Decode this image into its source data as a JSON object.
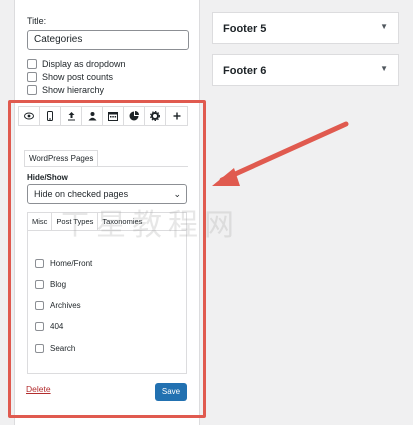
{
  "widget": {
    "title_label": "Title:",
    "title_value": "Categories",
    "options": [
      {
        "label": "Display as dropdown",
        "checked": false
      },
      {
        "label": "Show post counts",
        "checked": false
      },
      {
        "label": "Show hierarchy",
        "checked": false
      }
    ]
  },
  "visibility": {
    "toolbar_icons": [
      "eye-icon",
      "mobile-icon",
      "upload-icon",
      "user-icon",
      "calendar-icon",
      "pie-chart-icon",
      "gear-icon",
      "plus-icon"
    ],
    "tab": "WordPress Pages",
    "hide_show_label": "Hide/Show",
    "select_value": "Hide on checked pages",
    "subtabs": [
      "Misc",
      "Post Types",
      "Taxonomies"
    ],
    "misc_options": [
      "Home/Front",
      "Blog",
      "Archives",
      "404",
      "Search"
    ]
  },
  "actions": {
    "delete_label": "Delete",
    "save_label": "Save"
  },
  "footers": [
    {
      "title": "Footer 5"
    },
    {
      "title": "Footer 6"
    }
  ],
  "watermark": "ㄒ星教程网",
  "colors": {
    "highlight": "#e05a4f",
    "save_button": "#2271b1",
    "delete_link": "#b32d2e"
  }
}
